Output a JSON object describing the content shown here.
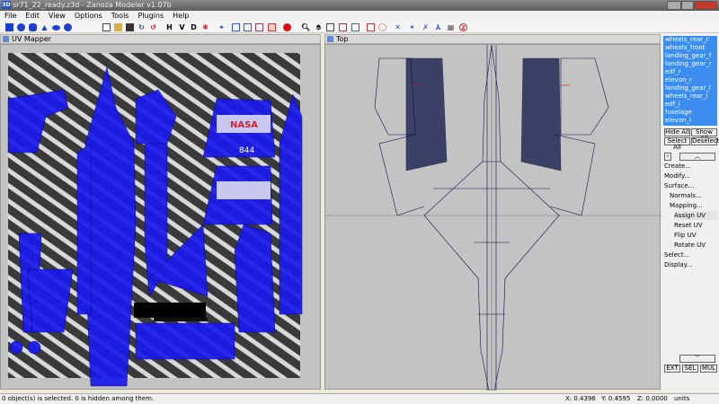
{
  "window": {
    "title": "sr71_22_ready.z3d - Zanoza Modeler v1.07b",
    "app_icon": "3D"
  },
  "menu": [
    "File",
    "Edit",
    "View",
    "Options",
    "Tools",
    "Plugins",
    "Help"
  ],
  "toolbar": {
    "text_buttons": [
      "H",
      "V",
      "D"
    ]
  },
  "panels": {
    "uv_mapper": {
      "title": "UV Mapper",
      "texture_text": [
        "NASA",
        "844"
      ]
    },
    "top": {
      "title": "Top"
    }
  },
  "side": {
    "objects": [
      "wheels_rear_r",
      "wheels_front",
      "landing_gear_f",
      "landing_gear_r",
      "edf_r",
      "elevon_r",
      "landing_gear_l",
      "wheels_rear_l",
      "edf_l",
      "fuselage",
      "elevon_l"
    ],
    "hide_all": "Hide All",
    "show_all": "Show All",
    "select_all": "Select All",
    "deselect": "Deselect",
    "menu": {
      "create": "Create...",
      "modify": "Modify...",
      "surface": "Surface...",
      "normals": "Normals...",
      "mapping": "Mapping...",
      "assign_uv": "Assign UV",
      "reset_uv": "Reset UV",
      "flip_uv": "Flip UV",
      "rotate_uv": "Rotate UV",
      "select": "Select...",
      "display": "Display..."
    },
    "ext": "EXT",
    "sel": "SEL",
    "mul": "MUL"
  },
  "status": {
    "message": "0 object(s) is selected. 0 is hidden among them.",
    "x": "X: 0.4396",
    "y": "Y: 0.4595",
    "z": "Z: 0.0000",
    "units": "units"
  }
}
